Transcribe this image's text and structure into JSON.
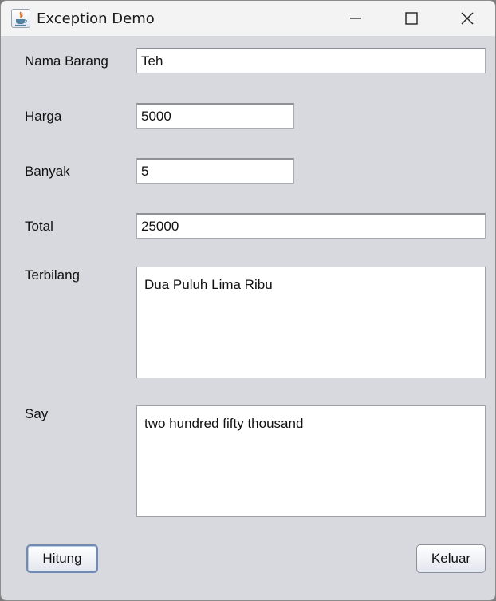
{
  "window": {
    "title": "Exception Demo",
    "icon": "java-icon"
  },
  "form": {
    "nama_barang": {
      "label": "Nama Barang",
      "value": "Teh"
    },
    "harga": {
      "label": "Harga",
      "value": "5000"
    },
    "banyak": {
      "label": "Banyak",
      "value": "5"
    },
    "total": {
      "label": "Total",
      "value": "25000"
    },
    "terbilang": {
      "label": "Terbilang",
      "value": "Dua Puluh Lima Ribu"
    },
    "say": {
      "label": "Say",
      "value": "two hundred fifty  thousand"
    }
  },
  "buttons": {
    "hitung": "Hitung",
    "keluar": "Keluar"
  }
}
